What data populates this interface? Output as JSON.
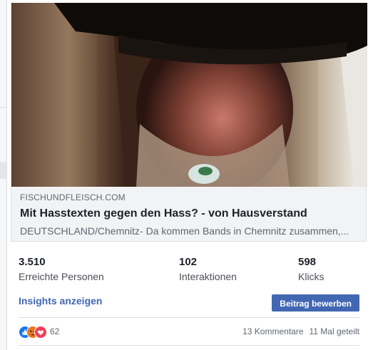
{
  "preview": {
    "domain": "FISCHUNDFLEISCH.COM",
    "headline": "Mit Hasstexten gegen den Hass? - von Hausverstand",
    "description": "DEUTSCHLAND/Chemnitz- Da kommen Bands in Chemnitz zusammen,..."
  },
  "stats": [
    {
      "value": "3.510",
      "label": "Erreichte Personen"
    },
    {
      "value": "102",
      "label": "Interaktionen"
    },
    {
      "value": "598",
      "label": "Klicks"
    }
  ],
  "actions": {
    "insights_label": "Insights anzeigen",
    "boost_label": "Beitrag bewerben"
  },
  "footer": {
    "reactions": [
      "like-icon",
      "angry-icon",
      "love-icon"
    ],
    "reaction_count": "62",
    "comments": "13 Kommentare",
    "shares": "11 Mal geteilt"
  },
  "colors": {
    "link": "#4267b2",
    "button": "#4267b2",
    "text_primary": "#1d2129",
    "text_secondary": "#606770"
  }
}
